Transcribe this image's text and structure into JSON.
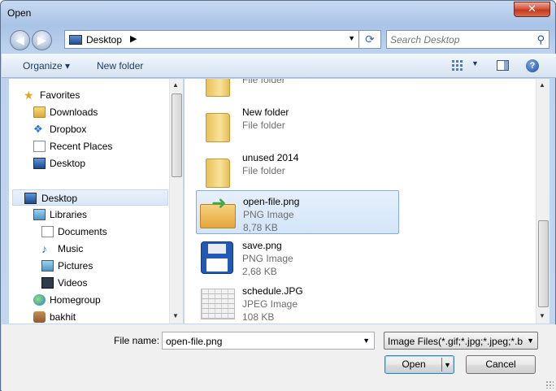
{
  "window": {
    "title": "Open",
    "close_glyph": "✕"
  },
  "address": {
    "location": "Desktop",
    "separator": "▶",
    "dropdown_glyph": "▼",
    "refresh_glyph": "⟳"
  },
  "search": {
    "placeholder": "Search Desktop",
    "icon": "magnifier-icon"
  },
  "nav_buttons": {
    "back_glyph": "◀",
    "forward_glyph": "▶"
  },
  "toolbar": {
    "organize_label": "Organize ▾",
    "new_folder_label": "New folder",
    "view_dropdown_glyph": "▼",
    "help_glyph": "?"
  },
  "navpane": {
    "items": [
      {
        "label": "Favorites",
        "icon": "star-icon"
      },
      {
        "label": "Downloads",
        "icon": "folder-icon"
      },
      {
        "label": "Dropbox",
        "icon": "dropbox-icon"
      },
      {
        "label": "Recent Places",
        "icon": "recent-places-icon"
      },
      {
        "label": "Desktop",
        "icon": "desktop-icon"
      },
      {
        "label": "Desktop",
        "icon": "desktop-icon",
        "selected": true
      },
      {
        "label": "Libraries",
        "icon": "libraries-icon"
      },
      {
        "label": "Documents",
        "icon": "document-icon"
      },
      {
        "label": "Music",
        "icon": "music-icon"
      },
      {
        "label": "Pictures",
        "icon": "pictures-icon"
      },
      {
        "label": "Videos",
        "icon": "videos-icon"
      },
      {
        "label": "Homegroup",
        "icon": "homegroup-icon"
      },
      {
        "label": "bakhit",
        "icon": "user-icon"
      }
    ]
  },
  "files": [
    {
      "name": "",
      "type": "File folder",
      "size": ""
    },
    {
      "name": "New folder",
      "type": "File folder",
      "size": ""
    },
    {
      "name": "unused 2014",
      "type": "File folder",
      "size": ""
    },
    {
      "name": "open-file.png",
      "type": "PNG Image",
      "size": "8,78 KB",
      "selected": true
    },
    {
      "name": "save.png",
      "type": "PNG Image",
      "size": "2,68 KB"
    },
    {
      "name": "schedule.JPG",
      "type": "JPEG Image",
      "size": "108 KB"
    }
  ],
  "footer": {
    "file_name_label": "File name:",
    "file_name_value": "open-file.png",
    "filter_value": "Image Files(*.gif;*.jpg;*.jpeg;*.b",
    "open_label": "Open",
    "cancel_label": "Cancel",
    "dropdown_glyph": "▼"
  },
  "scroll_glyphs": {
    "up": "▲",
    "down": "▼"
  }
}
